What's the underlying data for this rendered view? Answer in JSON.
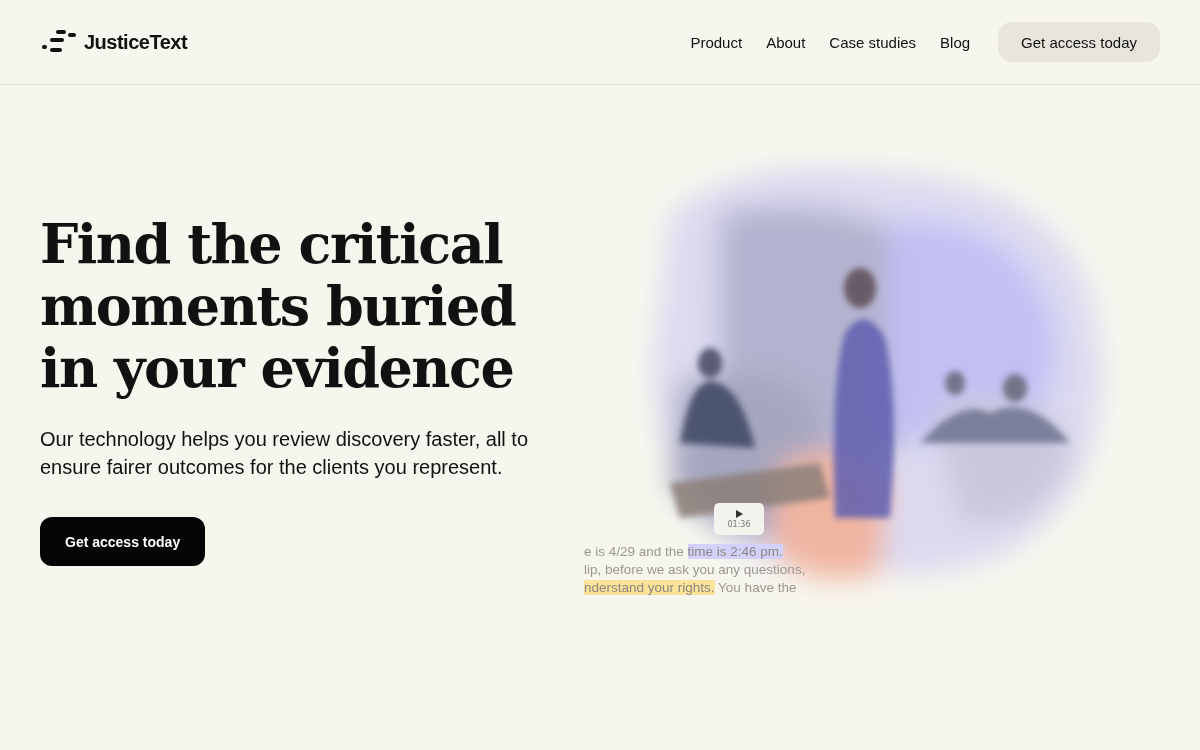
{
  "header": {
    "logo": "JusticeText",
    "nav": [
      "Product",
      "About",
      "Case studies",
      "Blog"
    ],
    "cta": "Get access today"
  },
  "hero": {
    "title": "Find the critical moments buried in your evidence",
    "subtitle": "Our technology helps you review discovery faster, all to ensure fairer outcomes for the clients you represent.",
    "cta": "Get access today"
  },
  "player": {
    "time": "01:36"
  },
  "transcript": [
    {
      "segments": [
        {
          "text": "e is 4/29 and the "
        },
        {
          "text": "time is 2:46 pm.",
          "color": "#d4d1fb"
        }
      ]
    },
    {
      "segments": [
        {
          "text": "lip, before we ask you any questions,"
        }
      ]
    },
    {
      "segments": [
        {
          "text": "nderstand your rights.",
          "color": "#fbe39a"
        },
        {
          "text": " You have the"
        }
      ]
    }
  ]
}
